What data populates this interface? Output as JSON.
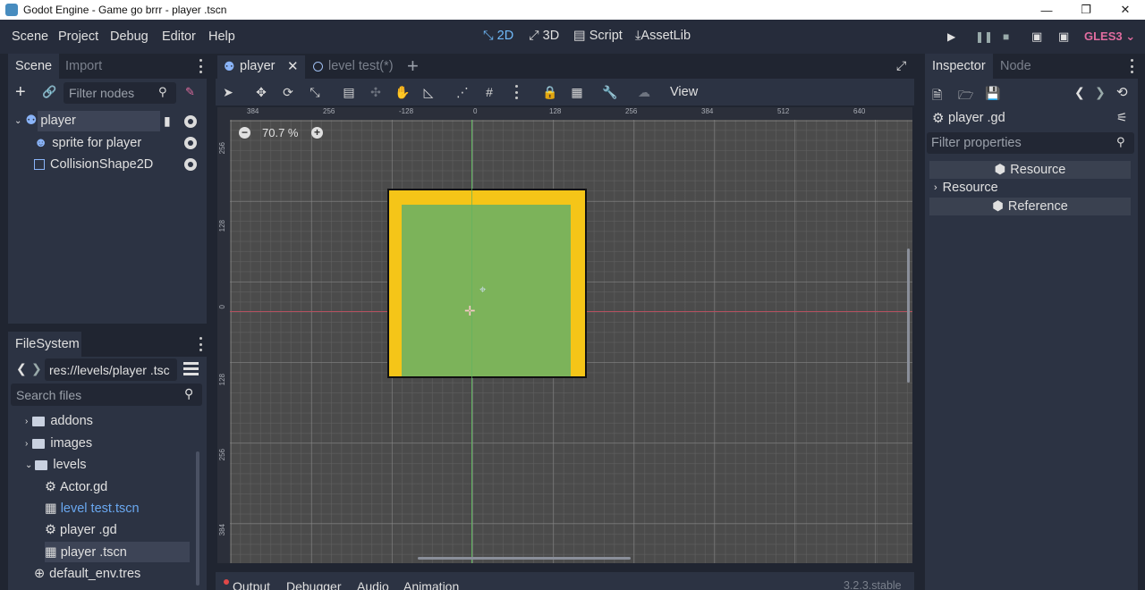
{
  "window": {
    "title": "Godot Engine - Game go brrr - player .tscn"
  },
  "menubar": {
    "menus": [
      "Scene",
      "Project",
      "Debug",
      "Editor",
      "Help"
    ],
    "modes": [
      "2D",
      "3D",
      "Script",
      "AssetLib"
    ],
    "renderer": "GLES3"
  },
  "scene_dock": {
    "tabs": [
      "Scene",
      "Import"
    ],
    "filter_placeholder": "Filter nodes",
    "nodes": [
      "player",
      "sprite for player",
      "CollisionShape2D"
    ]
  },
  "filesystem_dock": {
    "title": "FileSystem",
    "path": "res://levels/player .tsc",
    "search_placeholder": "Search files",
    "entries": [
      "addons",
      "images",
      "levels",
      "Actor.gd",
      "level test.tscn",
      "player .gd",
      "player .tscn",
      "default_env.tres"
    ]
  },
  "editor": {
    "tabs": [
      "player",
      "level test(*)"
    ],
    "view_menu": "View",
    "zoom": "70.7 %",
    "ruler_h": [
      "384",
      "256",
      "-128",
      "0",
      "128",
      "256",
      "384",
      "512",
      "640"
    ],
    "ruler_v": [
      "256",
      "128",
      "0",
      "128",
      "256",
      "384"
    ]
  },
  "inspector": {
    "tabs": [
      "Inspector",
      "Node"
    ],
    "object": "player .gd",
    "filter_placeholder": "Filter properties",
    "sections": [
      "Resource",
      "Resource",
      "Reference"
    ]
  },
  "bottom_panel": {
    "tabs": [
      "Output",
      "Debugger",
      "Audio",
      "Animation"
    ],
    "version": "3.2.3.stable"
  },
  "colors": {
    "accent": "#70bafa",
    "sprite_border": "#f5c518",
    "sprite_fill": "#7cb35a"
  }
}
